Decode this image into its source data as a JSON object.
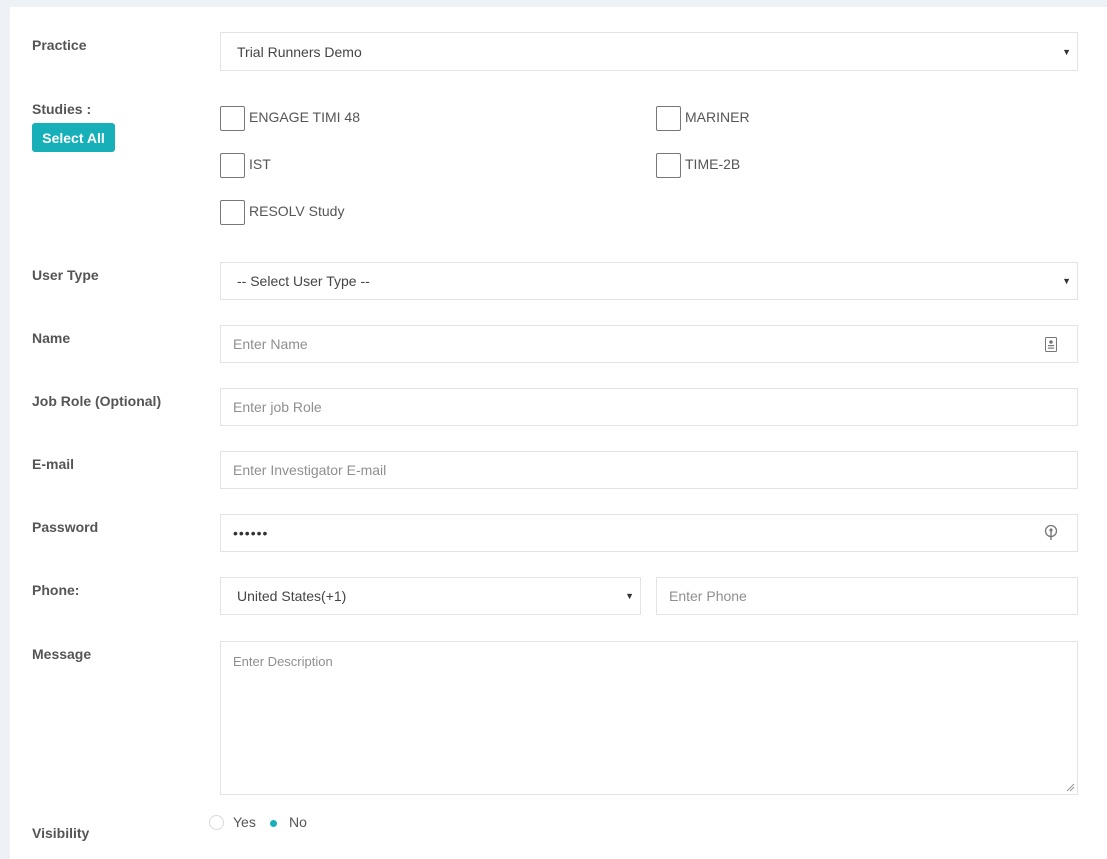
{
  "practice": {
    "label": "Practice",
    "selected": "Trial Runners Demo"
  },
  "studies": {
    "label": "Studies :",
    "select_all": "Select All",
    "items": [
      {
        "label": "ENGAGE TIMI 48",
        "checked": false
      },
      {
        "label": "MARINER",
        "checked": false
      },
      {
        "label": "IST",
        "checked": false
      },
      {
        "label": "TIME-2B",
        "checked": false
      },
      {
        "label": "RESOLV Study",
        "checked": false
      }
    ]
  },
  "user_type": {
    "label": "User Type",
    "selected": "-- Select User Type --"
  },
  "name": {
    "label": "Name",
    "placeholder": "Enter Name",
    "icon": "contact-card-icon"
  },
  "job_role": {
    "label": "Job Role (Optional)",
    "placeholder": "Enter job Role"
  },
  "email": {
    "label": "E-mail",
    "placeholder": "Enter Investigator E-mail"
  },
  "password": {
    "label": "Password",
    "value": "••••••",
    "icon": "key-icon"
  },
  "phone": {
    "label": "Phone:",
    "country": "United States(+1)",
    "placeholder": "Enter Phone"
  },
  "message": {
    "label": "Message",
    "placeholder": "Enter Description"
  },
  "visibility": {
    "label": "Visibility",
    "options": [
      {
        "label": "Yes",
        "checked": false
      },
      {
        "label": "No",
        "checked": true
      }
    ]
  },
  "colors": {
    "accent": "#17b0b8",
    "border": "#e3e3e3",
    "background": "#eef1f5"
  }
}
